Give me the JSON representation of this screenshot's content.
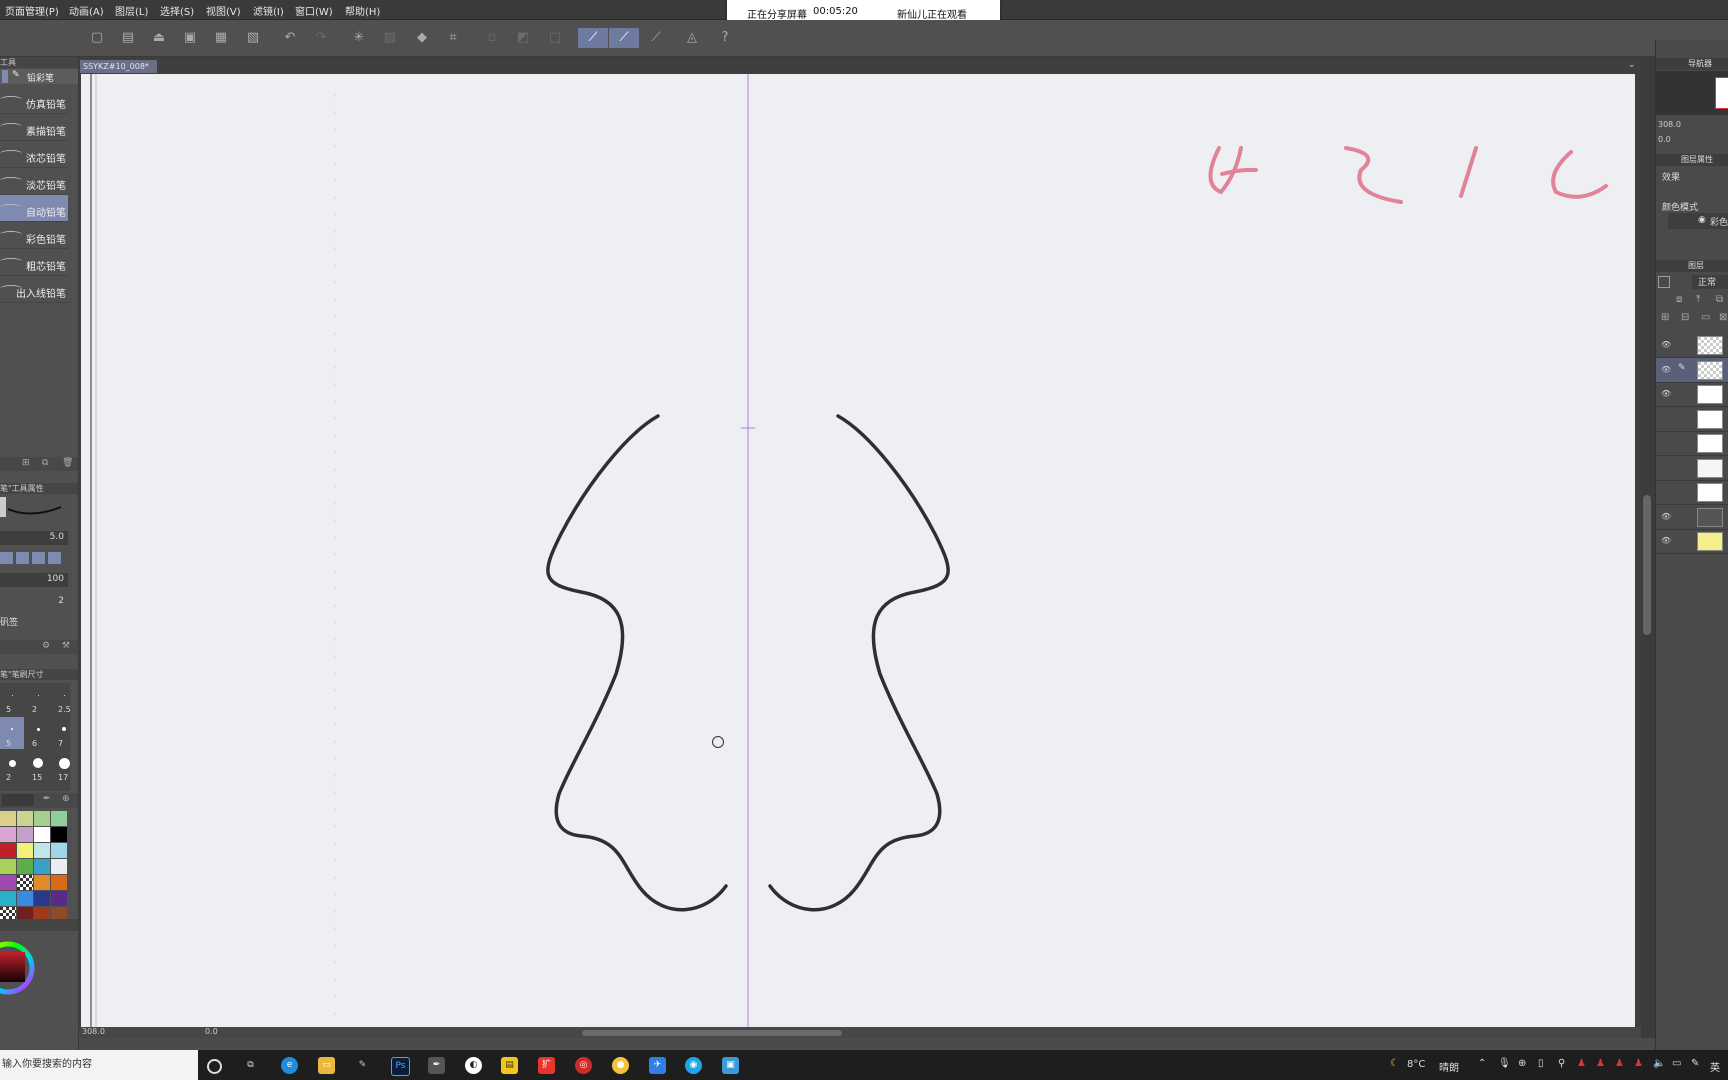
{
  "menu": {
    "items": [
      "页面管理(P)",
      "动画(A)",
      "图层(L)",
      "选择(S)",
      "视图(V)",
      "滤镜(I)",
      "窗口(W)",
      "帮助(H)"
    ]
  },
  "share_banner": {
    "status": "正在分享屏幕",
    "timer": "00:05:20",
    "viewer": "新仙儿正在观看"
  },
  "document": {
    "tab_title": "SSYKZ#10_008*"
  },
  "left_panel": {
    "tool_header": "工具",
    "subtool_tab": "铅彩笔",
    "brushes": [
      "仿真铅笔",
      "素描铅笔",
      "浓芯铅笔",
      "淡芯铅笔",
      "自动铅笔",
      "彩色铅笔",
      "粗芯铅笔",
      "出入线铅笔"
    ],
    "selected_brush_index": 4,
    "tool_property_header": "笔\"工具属性",
    "brush_size": "5.0",
    "opacity": "100",
    "stabilization": "2",
    "misc_label": "矾签",
    "brush_size_header": "笔\"笔刷尺寸",
    "size_presets": [
      [
        "5",
        "2",
        "2.5"
      ],
      [
        "5",
        "6",
        "7"
      ],
      [
        "2",
        "15",
        "17"
      ]
    ]
  },
  "canvas": {
    "zoom_readout": "308.0",
    "angle_readout": "0.0"
  },
  "right_panel": {
    "navigator_label": "导航器",
    "nav_zoom": "308.0",
    "nav_angle": "0.0",
    "layer_property_label": "图层属性",
    "effect_label": "效果",
    "color_mode_label": "颜色模式",
    "color_mode_value": "彩色",
    "layers_label": "图层",
    "blend_mode": "正常",
    "layer_count": 9,
    "visible_layers": [
      true,
      true,
      true,
      false,
      false,
      false,
      false,
      true,
      true
    ],
    "selected_layer_index": 1
  },
  "taskbar": {
    "search_placeholder": "输入你要搜索的内容",
    "weather_temp": "8°C",
    "weather_desc": "晴朗",
    "ime": "英"
  },
  "colors": {
    "accent": "#6f7aa0",
    "paper": "#eeeff2",
    "guide": "#b27fdc",
    "ink": "#2f2f2f",
    "red_sketch": "#e0708a"
  }
}
